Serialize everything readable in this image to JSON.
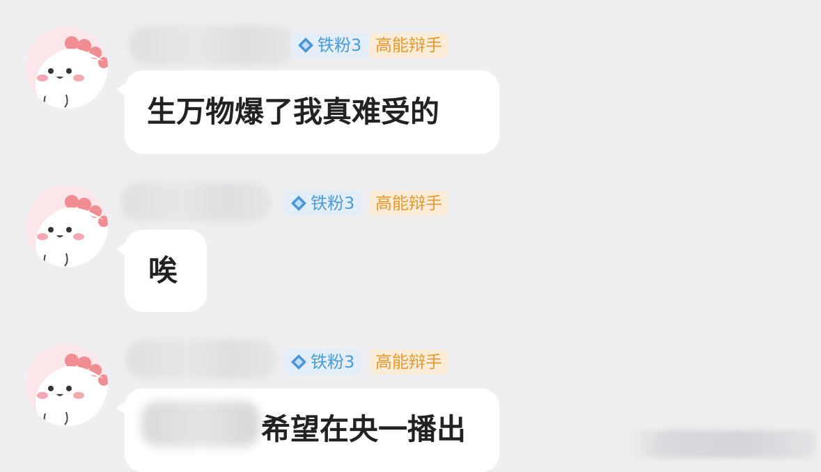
{
  "messages": [
    {
      "fan_badge": "铁粉3",
      "title_badge": "高能辩手",
      "text": "生万物爆了我真难受的"
    },
    {
      "fan_badge": "铁粉3",
      "title_badge": "高能辩手",
      "text": "唉"
    },
    {
      "fan_badge": "铁粉3",
      "title_badge": "高能辩手",
      "text": "希望在央一播出"
    }
  ],
  "icons": {
    "avatar": "cartoon-face-avatar",
    "fan_badge": "blue-diamond-icon"
  },
  "colors": {
    "background": "#efeff1",
    "bubble": "#ffffff",
    "fan_badge_bg": "#e3eef8",
    "fan_badge_text": "#4b9bd6",
    "title_badge_bg": "#faecd6",
    "title_badge_text": "#e59a31"
  }
}
